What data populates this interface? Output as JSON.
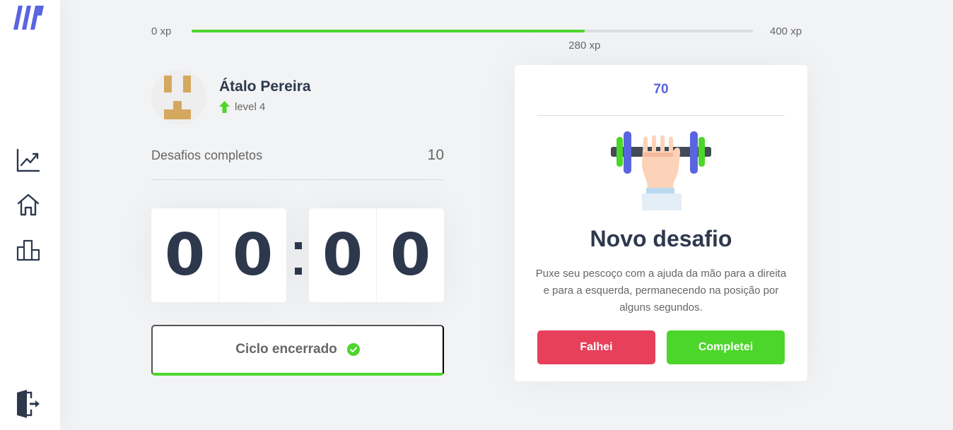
{
  "sidebar": {
    "logo_icon": "logo-three-bars",
    "nav_icons": [
      "chart-line-icon",
      "home-icon",
      "leaderboard-icon"
    ],
    "logout_icon": "logout-icon"
  },
  "xp_bar": {
    "min_label": "0 xp",
    "max_label": "400 xp",
    "current_label": "280 xp",
    "progress_fraction": 0.7
  },
  "profile": {
    "name": "Átalo Pereira",
    "level_label": "level 4"
  },
  "completed_challenges": {
    "label": "Desafios completos",
    "count": "10"
  },
  "countdown": {
    "minute_left": "0",
    "minute_right": "0",
    "second_left": "0",
    "second_right": "0"
  },
  "cycle_button": {
    "label": "Ciclo encerrado"
  },
  "challenge": {
    "amount": "70",
    "title": "Novo desafio",
    "description": "Puxe seu pescoço com a ajuda da mão para a direita e para a esquerda, permanecendo na posição por alguns segundos.",
    "failed_label": "Falhei",
    "succeeded_label": "Completei"
  },
  "colors": {
    "accent_blue": "#5965e0",
    "green": "#4cd62b",
    "red": "#e83f5b",
    "title_dark": "#2e384d",
    "text_gray": "#666666",
    "background": "#f2f3f5"
  }
}
